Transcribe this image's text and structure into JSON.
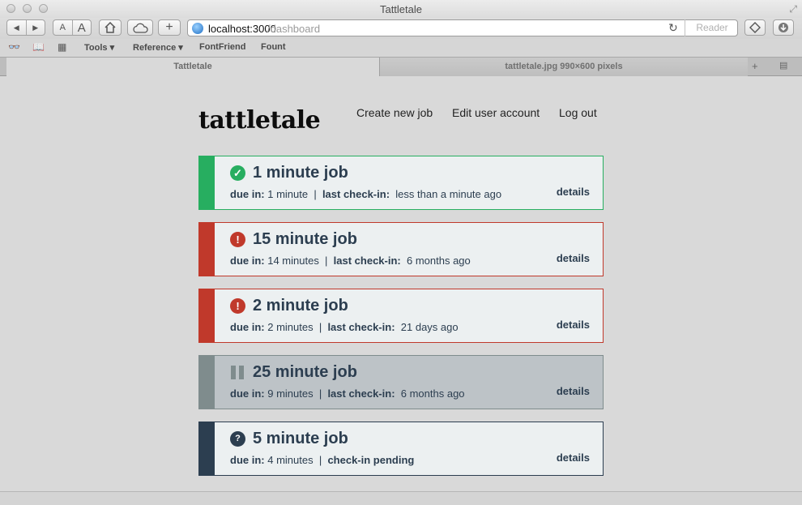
{
  "window": {
    "title": "Tattletale"
  },
  "toolbar": {
    "back_icon": "◀",
    "forward_icon": "▶",
    "font_small": "A",
    "font_large": "A",
    "url_host": "localhost:3000",
    "url_path": "/dashboard",
    "reader_label": "Reader"
  },
  "bookmarks": {
    "items": [
      {
        "label": "Tools ▾"
      },
      {
        "label": "Reference ▾"
      },
      {
        "label": "FontFriend"
      },
      {
        "label": "Fount"
      }
    ]
  },
  "tabs": [
    {
      "label": "Tattletale"
    },
    {
      "label": "tattletale.jpg 990×600 pixels"
    }
  ],
  "app": {
    "brand": "tattletale",
    "nav": [
      {
        "label": "Create new job"
      },
      {
        "label": "Edit user account"
      },
      {
        "label": "Log out"
      }
    ]
  },
  "colors": {
    "ok": "#27ae60",
    "error": "#c0392b",
    "paused": "#7f8c8d",
    "pending": "#2c3e50"
  },
  "jobs": [
    {
      "title": "1 minute job",
      "status": "ok",
      "icon": "check-circle-icon",
      "due_label": "due in:",
      "due_value": "1 minute",
      "checkin_label": "last check-in:",
      "checkin_value": "less than a minute ago",
      "details": "details"
    },
    {
      "title": "15 minute job",
      "status": "error",
      "icon": "exclamation-circle-icon",
      "due_label": "due in:",
      "due_value": "14 minutes",
      "checkin_label": "last check-in:",
      "checkin_value": "6 months ago",
      "details": "details"
    },
    {
      "title": "2 minute job",
      "status": "error",
      "icon": "exclamation-circle-icon",
      "due_label": "due in:",
      "due_value": "2 minutes",
      "checkin_label": "last check-in:",
      "checkin_value": "21 days ago",
      "details": "details"
    },
    {
      "title": "25 minute job",
      "status": "paused",
      "icon": "pause-icon",
      "due_label": "due in:",
      "due_value": "9 minutes",
      "checkin_label": "last check-in:",
      "checkin_value": "6 months ago",
      "details": "details"
    },
    {
      "title": "5 minute job",
      "status": "pending",
      "icon": "question-circle-icon",
      "due_label": "due in:",
      "due_value": "4 minutes",
      "checkin_label": "check-in pending",
      "checkin_value": "",
      "details": "details"
    }
  ]
}
